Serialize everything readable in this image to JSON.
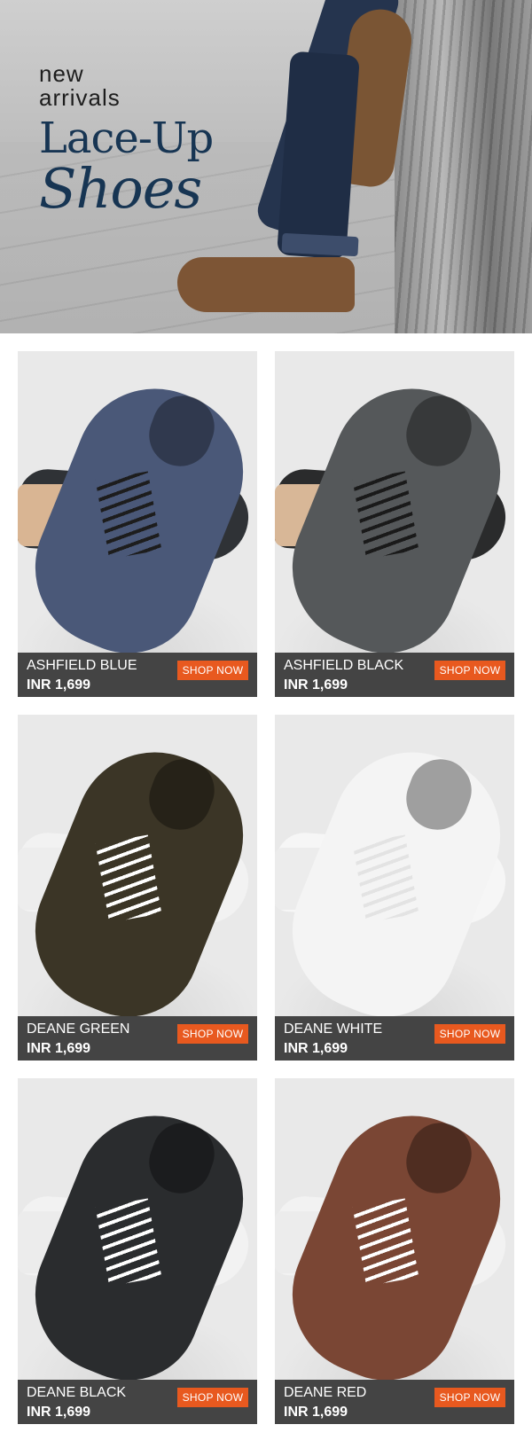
{
  "hero": {
    "line1": "new",
    "line2": "arrivals",
    "line3": "Lace-Up",
    "line4": "Shoes"
  },
  "products": [
    {
      "name": "ASHFIELD BLUE",
      "price": "INR 1,699",
      "cta": "SHOP NOW",
      "color": "#4a5878",
      "sole": "#2f3236",
      "inner": "#d9b593",
      "lace": "#1d1d1d"
    },
    {
      "name": "ASHFIELD BLACK",
      "price": "INR 1,699",
      "cta": "SHOP NOW",
      "color": "#55585a",
      "sole": "#2a2b2c",
      "inner": "#d8b797",
      "lace": "#1a1a1a"
    },
    {
      "name": "DEANE GREEN",
      "price": "INR 1,699",
      "cta": "SHOP NOW",
      "color": "#3b3526",
      "sole": "#f2f2f2",
      "inner": "#ededed",
      "lace": "#ffffff"
    },
    {
      "name": "DEANE WHITE",
      "price": "INR 1,699",
      "cta": "SHOP NOW",
      "color": "#f4f4f4",
      "sole": "#f6f6f6",
      "inner": "#ececec",
      "lace": "#e3e3e3"
    },
    {
      "name": "DEANE BLACK",
      "price": "INR 1,699",
      "cta": "SHOP NOW",
      "color": "#2a2c2e",
      "sole": "#f2f2f2",
      "inner": "#ececec",
      "lace": "#ffffff"
    },
    {
      "name": "DEANE RED",
      "price": "INR 1,699",
      "cta": "SHOP NOW",
      "color": "#7a4634",
      "sole": "#f2f2f2",
      "inner": "#ececec",
      "lace": "#ffffff"
    }
  ],
  "theme": {
    "bar": "#444444",
    "button": "#e8591f",
    "heading": "#173553"
  }
}
